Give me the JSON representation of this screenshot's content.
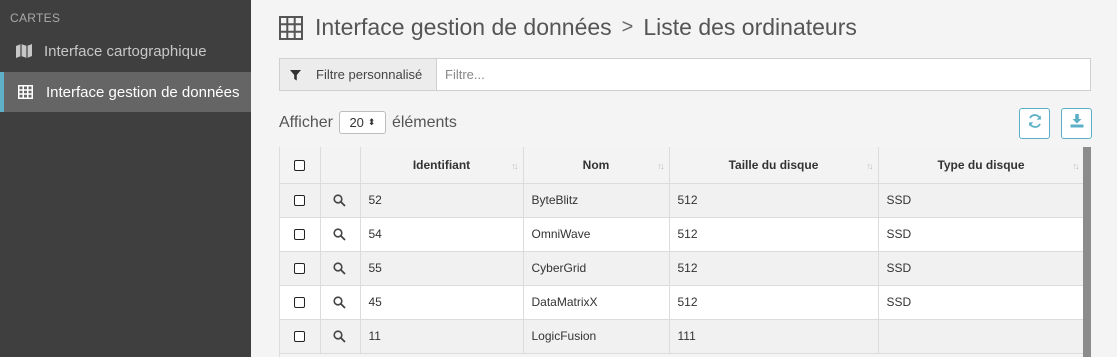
{
  "sidebar": {
    "section_label": "CARTES",
    "items": [
      {
        "label": "Interface cartographique",
        "icon": "map-icon",
        "active": false
      },
      {
        "label": "Interface gestion de données",
        "icon": "grid-icon",
        "active": true
      }
    ]
  },
  "header": {
    "breadcrumb_parent": "Interface gestion de données",
    "separator": ">",
    "breadcrumb_current": "Liste des ordinateurs",
    "icon": "grid-icon"
  },
  "filter": {
    "button_label": "Filtre personnalisé",
    "icon": "filter-icon",
    "placeholder": "Filtre..."
  },
  "pagination": {
    "prefix": "Afficher",
    "page_size": "20",
    "suffix": "éléments"
  },
  "toolbar": {
    "refresh_icon": "refresh-icon",
    "download_icon": "download-icon"
  },
  "table": {
    "columns": [
      "Identifiant",
      "Nom",
      "Taille du disque",
      "Type du disque"
    ],
    "rows": [
      {
        "id": "52",
        "name": "ByteBlitz",
        "size": "512",
        "type": "SSD"
      },
      {
        "id": "54",
        "name": "OmniWave",
        "size": "512",
        "type": "SSD"
      },
      {
        "id": "55",
        "name": "CyberGrid",
        "size": "512",
        "type": "SSD"
      },
      {
        "id": "45",
        "name": "DataMatrixX",
        "size": "512",
        "type": "SSD"
      },
      {
        "id": "11",
        "name": "LogicFusion",
        "size": "111",
        "type": ""
      }
    ]
  },
  "colors": {
    "accent": "#5bb0c8",
    "sidebar_bg": "#3f3f3f",
    "sidebar_active": "#656565"
  }
}
